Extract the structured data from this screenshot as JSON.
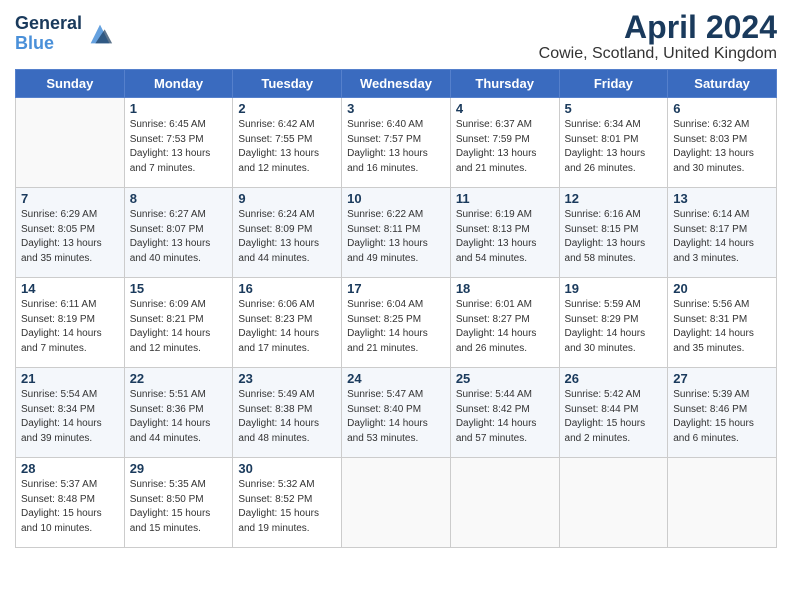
{
  "header": {
    "logo_line1": "General",
    "logo_line2": "Blue",
    "title": "April 2024",
    "subtitle": "Cowie, Scotland, United Kingdom"
  },
  "days_of_week": [
    "Sunday",
    "Monday",
    "Tuesday",
    "Wednesday",
    "Thursday",
    "Friday",
    "Saturday"
  ],
  "weeks": [
    [
      {
        "num": "",
        "sunrise": "",
        "sunset": "",
        "daylight": ""
      },
      {
        "num": "1",
        "sunrise": "6:45 AM",
        "sunset": "7:53 PM",
        "daylight": "13 hours and 7 minutes."
      },
      {
        "num": "2",
        "sunrise": "6:42 AM",
        "sunset": "7:55 PM",
        "daylight": "13 hours and 12 minutes."
      },
      {
        "num": "3",
        "sunrise": "6:40 AM",
        "sunset": "7:57 PM",
        "daylight": "13 hours and 16 minutes."
      },
      {
        "num": "4",
        "sunrise": "6:37 AM",
        "sunset": "7:59 PM",
        "daylight": "13 hours and 21 minutes."
      },
      {
        "num": "5",
        "sunrise": "6:34 AM",
        "sunset": "8:01 PM",
        "daylight": "13 hours and 26 minutes."
      },
      {
        "num": "6",
        "sunrise": "6:32 AM",
        "sunset": "8:03 PM",
        "daylight": "13 hours and 30 minutes."
      }
    ],
    [
      {
        "num": "7",
        "sunrise": "6:29 AM",
        "sunset": "8:05 PM",
        "daylight": "13 hours and 35 minutes."
      },
      {
        "num": "8",
        "sunrise": "6:27 AM",
        "sunset": "8:07 PM",
        "daylight": "13 hours and 40 minutes."
      },
      {
        "num": "9",
        "sunrise": "6:24 AM",
        "sunset": "8:09 PM",
        "daylight": "13 hours and 44 minutes."
      },
      {
        "num": "10",
        "sunrise": "6:22 AM",
        "sunset": "8:11 PM",
        "daylight": "13 hours and 49 minutes."
      },
      {
        "num": "11",
        "sunrise": "6:19 AM",
        "sunset": "8:13 PM",
        "daylight": "13 hours and 54 minutes."
      },
      {
        "num": "12",
        "sunrise": "6:16 AM",
        "sunset": "8:15 PM",
        "daylight": "13 hours and 58 minutes."
      },
      {
        "num": "13",
        "sunrise": "6:14 AM",
        "sunset": "8:17 PM",
        "daylight": "14 hours and 3 minutes."
      }
    ],
    [
      {
        "num": "14",
        "sunrise": "6:11 AM",
        "sunset": "8:19 PM",
        "daylight": "14 hours and 7 minutes."
      },
      {
        "num": "15",
        "sunrise": "6:09 AM",
        "sunset": "8:21 PM",
        "daylight": "14 hours and 12 minutes."
      },
      {
        "num": "16",
        "sunrise": "6:06 AM",
        "sunset": "8:23 PM",
        "daylight": "14 hours and 17 minutes."
      },
      {
        "num": "17",
        "sunrise": "6:04 AM",
        "sunset": "8:25 PM",
        "daylight": "14 hours and 21 minutes."
      },
      {
        "num": "18",
        "sunrise": "6:01 AM",
        "sunset": "8:27 PM",
        "daylight": "14 hours and 26 minutes."
      },
      {
        "num": "19",
        "sunrise": "5:59 AM",
        "sunset": "8:29 PM",
        "daylight": "14 hours and 30 minutes."
      },
      {
        "num": "20",
        "sunrise": "5:56 AM",
        "sunset": "8:31 PM",
        "daylight": "14 hours and 35 minutes."
      }
    ],
    [
      {
        "num": "21",
        "sunrise": "5:54 AM",
        "sunset": "8:34 PM",
        "daylight": "14 hours and 39 minutes."
      },
      {
        "num": "22",
        "sunrise": "5:51 AM",
        "sunset": "8:36 PM",
        "daylight": "14 hours and 44 minutes."
      },
      {
        "num": "23",
        "sunrise": "5:49 AM",
        "sunset": "8:38 PM",
        "daylight": "14 hours and 48 minutes."
      },
      {
        "num": "24",
        "sunrise": "5:47 AM",
        "sunset": "8:40 PM",
        "daylight": "14 hours and 53 minutes."
      },
      {
        "num": "25",
        "sunrise": "5:44 AM",
        "sunset": "8:42 PM",
        "daylight": "14 hours and 57 minutes."
      },
      {
        "num": "26",
        "sunrise": "5:42 AM",
        "sunset": "8:44 PM",
        "daylight": "15 hours and 2 minutes."
      },
      {
        "num": "27",
        "sunrise": "5:39 AM",
        "sunset": "8:46 PM",
        "daylight": "15 hours and 6 minutes."
      }
    ],
    [
      {
        "num": "28",
        "sunrise": "5:37 AM",
        "sunset": "8:48 PM",
        "daylight": "15 hours and 10 minutes."
      },
      {
        "num": "29",
        "sunrise": "5:35 AM",
        "sunset": "8:50 PM",
        "daylight": "15 hours and 15 minutes."
      },
      {
        "num": "30",
        "sunrise": "5:32 AM",
        "sunset": "8:52 PM",
        "daylight": "15 hours and 19 minutes."
      },
      {
        "num": "",
        "sunrise": "",
        "sunset": "",
        "daylight": ""
      },
      {
        "num": "",
        "sunrise": "",
        "sunset": "",
        "daylight": ""
      },
      {
        "num": "",
        "sunrise": "",
        "sunset": "",
        "daylight": ""
      },
      {
        "num": "",
        "sunrise": "",
        "sunset": "",
        "daylight": ""
      }
    ]
  ],
  "labels": {
    "sunrise_prefix": "Sunrise: ",
    "sunset_prefix": "Sunset: ",
    "daylight_prefix": "Daylight: "
  }
}
